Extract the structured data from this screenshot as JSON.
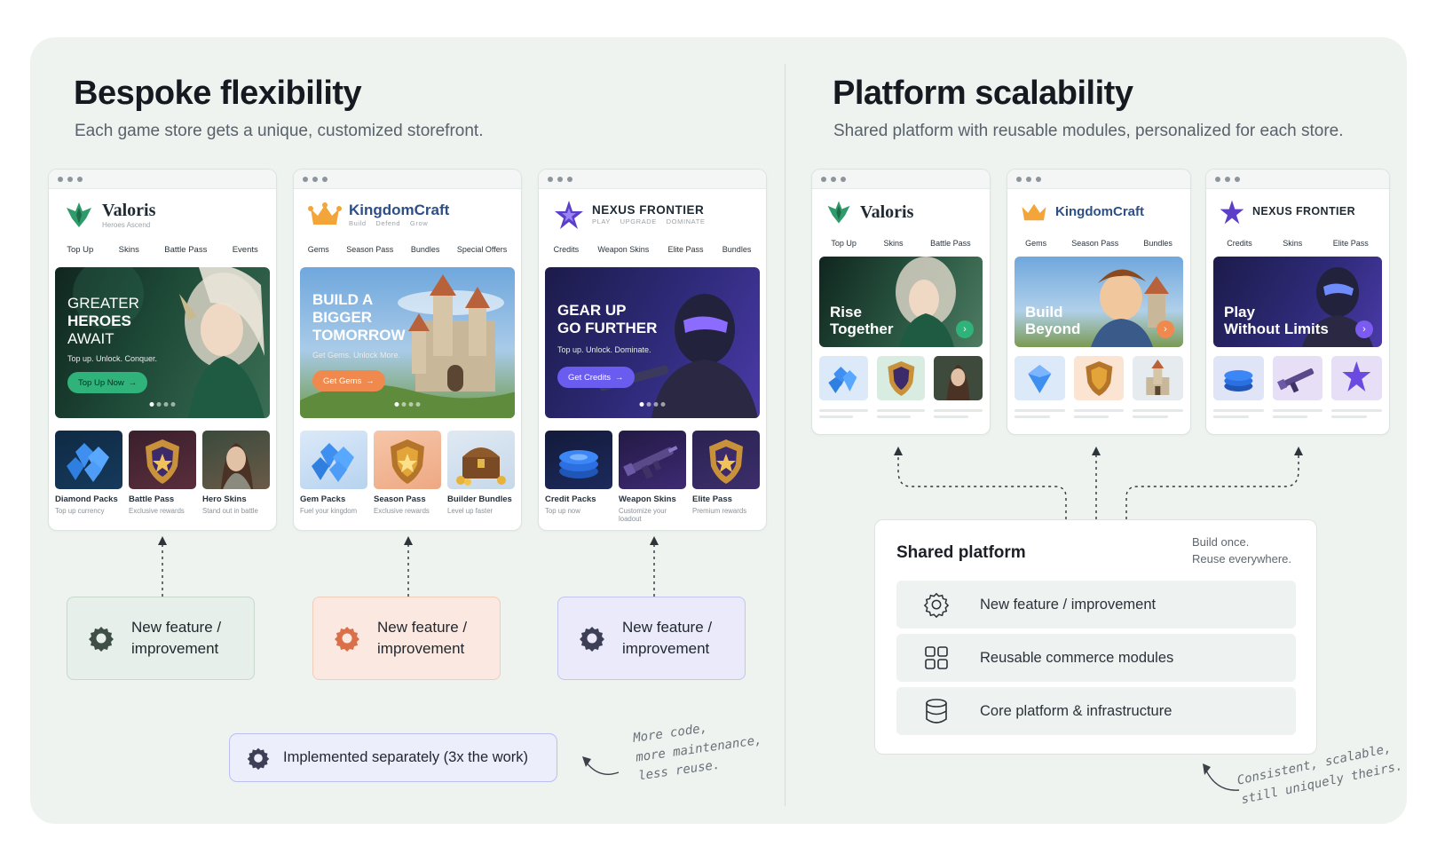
{
  "left": {
    "title": "Bespoke flexibility",
    "subtitle": "Each game store gets a unique, customized storefront.",
    "stores": [
      {
        "name": "Valoris",
        "tagline": "Heroes Ascend",
        "nav": [
          "Top Up",
          "Skins",
          "Battle Pass",
          "Events"
        ],
        "hero_lines": [
          "GREATER",
          "HEROES",
          "AWAIT"
        ],
        "hero_sub": "Top up. Unlock. Conquer.",
        "cta": "Top Up Now",
        "accent": "#2fb37b",
        "tiles": [
          {
            "title": "Diamond Packs",
            "sub": "Top up currency"
          },
          {
            "title": "Battle Pass",
            "sub": "Exclusive rewards"
          },
          {
            "title": "Hero Skins",
            "sub": "Stand out in battle"
          }
        ]
      },
      {
        "name": "KingdomCraft",
        "tagline": "Build    Defend    Grow",
        "nav": [
          "Gems",
          "Season Pass",
          "Bundles",
          "Special Offers"
        ],
        "hero_lines": [
          "BUILD A",
          "BIGGER",
          "TOMORROW"
        ],
        "hero_sub": "Get Gems. Unlock More.",
        "cta": "Get Gems",
        "accent": "#f0894d",
        "tiles": [
          {
            "title": "Gem Packs",
            "sub": "Fuel your kingdom"
          },
          {
            "title": "Season Pass",
            "sub": "Exclusive rewards"
          },
          {
            "title": "Builder Bundles",
            "sub": "Level up faster"
          }
        ]
      },
      {
        "name": "NEXUS FRONTIER",
        "tagline": "PLAY    UPGRADE    DOMINATE",
        "nav": [
          "Credits",
          "Weapon Skins",
          "Elite Pass",
          "Bundles"
        ],
        "hero_lines": [
          "GEAR UP",
          "GO FURTHER"
        ],
        "hero_sub": "Top up. Unlock. Dominate.",
        "cta": "Get Credits",
        "accent": "#6b5cf0",
        "tiles": [
          {
            "title": "Credit Packs",
            "sub": "Top up now"
          },
          {
            "title": "Weapon Skins",
            "sub": "Customize your loadout"
          },
          {
            "title": "Elite Pass",
            "sub": "Premium rewards"
          }
        ]
      }
    ],
    "feature_line1": "New feature /",
    "feature_line2": "improvement",
    "implemented": "Implemented separately (3x the work)",
    "note": [
      "More code,",
      "more maintenance,",
      "less reuse."
    ]
  },
  "right": {
    "title": "Platform scalability",
    "subtitle": "Shared platform with reusable modules, personalized for each store.",
    "stores": [
      {
        "name": "Valoris",
        "nav": [
          "Top Up",
          "Skins",
          "Battle Pass"
        ],
        "hero_lines": [
          "Rise",
          "Together"
        ],
        "accent": "#2fb37b"
      },
      {
        "name": "KingdomCraft",
        "nav": [
          "Gems",
          "Season Pass",
          "Bundles"
        ],
        "hero_lines": [
          "Build",
          "Beyond"
        ],
        "accent": "#f0894d"
      },
      {
        "name": "NEXUS FRONTIER",
        "nav": [
          "Credits",
          "Skins",
          "Elite Pass"
        ],
        "hero_lines": [
          "Play",
          "Without Limits"
        ],
        "accent": "#7c5cf0"
      }
    ],
    "shared_title": "Shared platform",
    "shared_note": [
      "Build once.",
      "Reuse everywhere."
    ],
    "rows": [
      {
        "label": "New feature / improvement",
        "icon": "gear-icon"
      },
      {
        "label": "Reusable commerce modules",
        "icon": "grid-icon"
      },
      {
        "label": "Core platform & infrastructure",
        "icon": "database-icon"
      }
    ],
    "note": [
      "Consistent, scalable,",
      "still uniquely theirs."
    ]
  }
}
